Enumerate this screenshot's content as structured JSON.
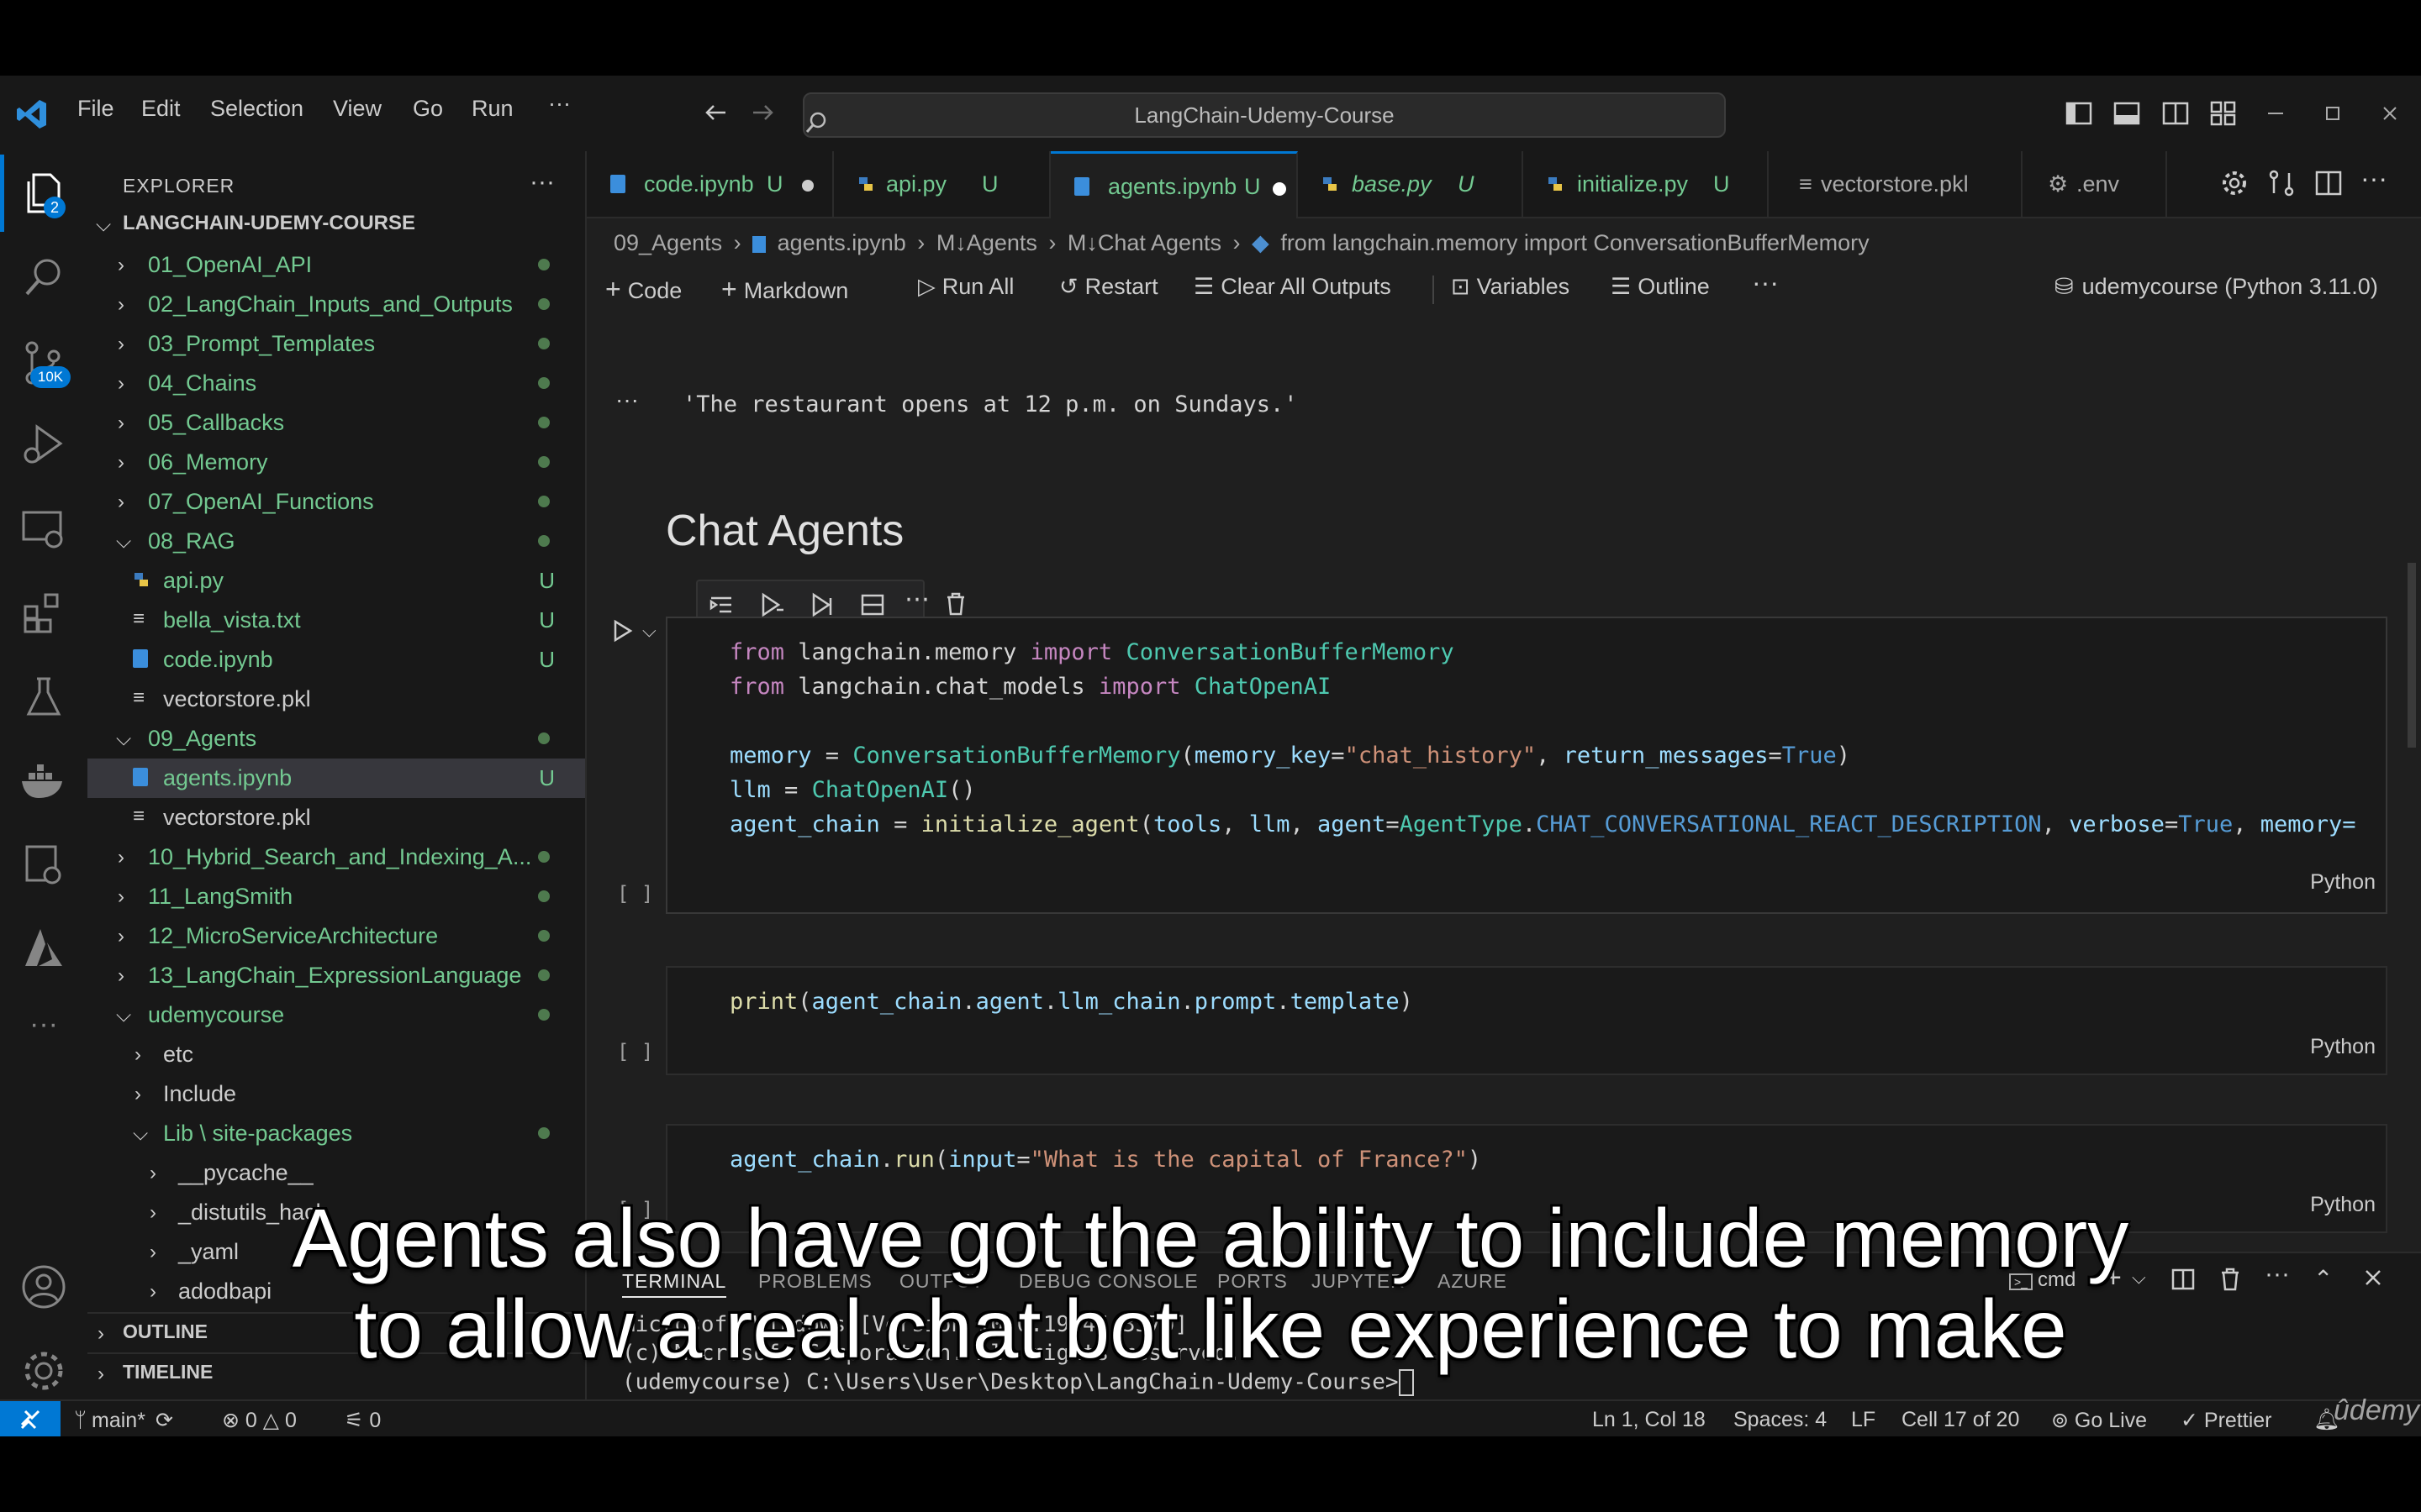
{
  "menu": {
    "items": [
      "File",
      "Edit",
      "Selection",
      "View",
      "Go",
      "Run"
    ],
    "more": "···"
  },
  "search": {
    "text": "LangChain-Udemy-Course"
  },
  "activity": {
    "explorer_badge": "2",
    "scm_badge": "10K"
  },
  "explorer": {
    "title": "EXPLORER",
    "more": "···",
    "root": "LANGCHAIN-UDEMY-COURSE",
    "items": [
      {
        "label": "01_OpenAI_API"
      },
      {
        "label": "02_LangChain_Inputs_and_Outputs"
      },
      {
        "label": "03_Prompt_Templates"
      },
      {
        "label": "04_Chains"
      },
      {
        "label": "05_Callbacks"
      },
      {
        "label": "06_Memory"
      },
      {
        "label": "07_OpenAI_Functions"
      },
      {
        "label": "08_RAG"
      },
      {
        "label": "api.py",
        "badge": "U"
      },
      {
        "label": "bella_vista.txt",
        "badge": "U"
      },
      {
        "label": "code.ipynb",
        "badge": "U"
      },
      {
        "label": "vectorstore.pkl"
      },
      {
        "label": "09_Agents"
      },
      {
        "label": "agents.ipynb",
        "badge": "U"
      },
      {
        "label": "vectorstore.pkl"
      },
      {
        "label": "10_Hybrid_Search_and_Indexing_A..."
      },
      {
        "label": "11_LangSmith"
      },
      {
        "label": "12_MicroServiceArchitecture"
      },
      {
        "label": "13_LangChain_ExpressionLanguage"
      },
      {
        "label": "udemycourse"
      },
      {
        "label": "etc"
      },
      {
        "label": "Include"
      },
      {
        "label": "Lib \\ site-packages"
      },
      {
        "label": "__pycache__"
      },
      {
        "label": "_distutils_hack"
      },
      {
        "label": "_yaml"
      },
      {
        "label": "adodbapi"
      }
    ],
    "outline": "OUTLINE",
    "timeline": "TIMELINE"
  },
  "tabs": [
    {
      "label": "code.ipynb",
      "badge": "U"
    },
    {
      "label": "api.py",
      "badge": "U"
    },
    {
      "label": "agents.ipynb",
      "badge": "U"
    },
    {
      "label": "base.py",
      "badge": "U"
    },
    {
      "label": "initialize.py",
      "badge": "U"
    },
    {
      "label": "vectorstore.pkl"
    },
    {
      "label": ".env"
    }
  ],
  "breadcrumb": [
    "09_Agents",
    "agents.ipynb",
    "M↓Agents",
    "M↓Chat Agents",
    "from langchain.memory import ConversationBufferMemory"
  ],
  "toolbar": {
    "code": "Code",
    "markdown": "Markdown",
    "run_all": "Run All",
    "restart": "Restart",
    "clear": "Clear All Outputs",
    "variables": "Variables",
    "outline": "Outline",
    "more": "···",
    "kernel": "udemycourse (Python 3.11.0)"
  },
  "notebook": {
    "output_dots": "···",
    "output": "'The restaurant opens at 12 p.m. on Sundays.'",
    "heading": "Chat Agents",
    "exec_marker": "[ ]",
    "lang": "Python",
    "cell1": {
      "l1a": "from",
      "l1b": "langchain.memory",
      "l1c": "import",
      "l1d": "ConversationBufferMemory",
      "l2a": "from",
      "l2b": "langchain.chat_models",
      "l2c": "import",
      "l2d": "ChatOpenAI",
      "l3a": "memory",
      "l3b": " = ",
      "l3c": "ConversationBufferMemory",
      "l3d": "(",
      "l3e": "memory_key",
      "l3f": "=",
      "l3g": "\"chat_history\"",
      "l3h": ", ",
      "l3i": "return_messages",
      "l3j": "=",
      "l3k": "True",
      "l3l": ")",
      "l4a": "llm",
      "l4b": " = ",
      "l4c": "ChatOpenAI",
      "l4d": "()",
      "l5a": "agent_chain",
      "l5b": " = ",
      "l5c": "initialize_agent",
      "l5d": "(",
      "l5e": "tools",
      "l5f": ", ",
      "l5g": "llm",
      "l5h": ", ",
      "l5i": "agent",
      "l5j": "=",
      "l5k": "AgentType",
      "l5l": ".",
      "l5m": "CHAT_CONVERSATIONAL_REACT_DESCRIPTION",
      "l5n": ", ",
      "l5o": "verbose",
      "l5p": "=",
      "l5q": "True",
      "l5r": ", ",
      "l5s": "memory="
    },
    "cell2": {
      "a": "print",
      "b": "(",
      "c": "agent_chain",
      "d": ".",
      "e": "agent",
      "f": ".",
      "g": "llm_chain",
      "h": ".",
      "i": "prompt",
      "j": ".",
      "k": "template",
      "l": ")"
    },
    "cell3": {
      "a": "agent_chain",
      "b": ".",
      "c": "run",
      "d": "(",
      "e": "input",
      "f": "=",
      "g": "\"What is the capital of France?\"",
      "h": ")"
    }
  },
  "panel": {
    "tabs": [
      "TERMINAL",
      "PROBLEMS",
      "OUTPUT",
      "DEBUG CONSOLE",
      "PORTS",
      "JUPYTER",
      "AZURE"
    ],
    "shell": "cmd",
    "lines": [
      "Microsoft Windows [Version 10.0.19045.3570]",
      "(c) Microsoft Corporation. All rights reserved.",
      "(udemycourse) C:\\Users\\User\\Desktop\\LangChain-Udemy-Course>"
    ]
  },
  "status": {
    "branch": "main*",
    "errors": "0",
    "warnings": "0",
    "ports": "0",
    "position": "Ln 1, Col 18",
    "spaces": "Spaces: 4",
    "eol": "LF",
    "cell": "Cell 17 of 20",
    "golive": "Go Live",
    "prettier": "Prettier",
    "watermark": "ûdemy"
  },
  "caption": {
    "line1": "Agents also have got the ability to include memory",
    "line2": "to allow a real chat bot like experience to make"
  },
  "colors": {
    "accent": "#0078d4",
    "keyword": "#c586c0",
    "function": "#dcdcaa",
    "variable": "#9cdcfe",
    "string": "#ce9178",
    "class": "#4ec9b0",
    "constant": "#569cd6",
    "untracked": "#73c991"
  }
}
